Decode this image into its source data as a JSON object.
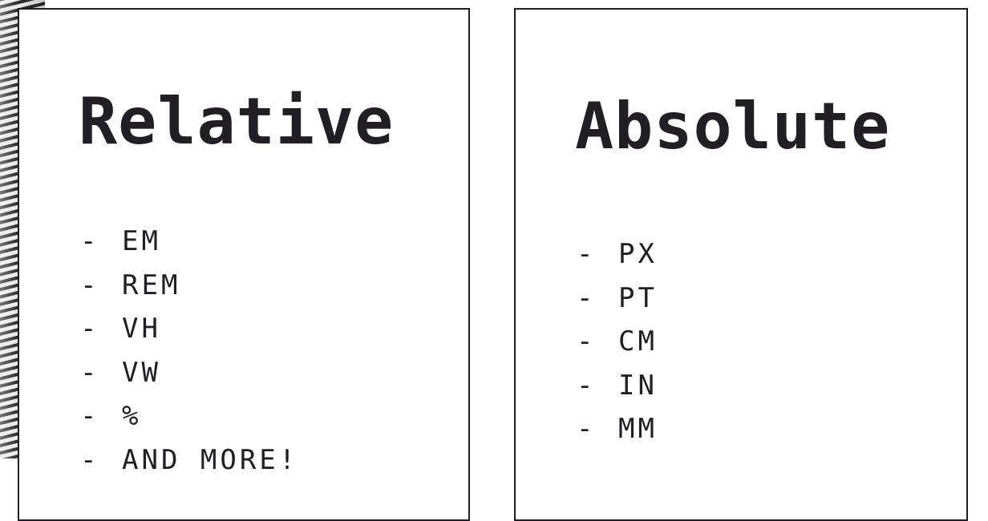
{
  "cards": [
    {
      "title": "Relative",
      "dash": "-",
      "items": [
        "EM",
        "REM",
        "VH",
        "VW",
        "%",
        "AND MORE!"
      ]
    },
    {
      "title": "Absolute",
      "dash": "-",
      "items": [
        "PX",
        "PT",
        "CM",
        "IN",
        "MM"
      ]
    }
  ],
  "colors": {
    "ink": "#221f24",
    "background": "#ffffff"
  }
}
